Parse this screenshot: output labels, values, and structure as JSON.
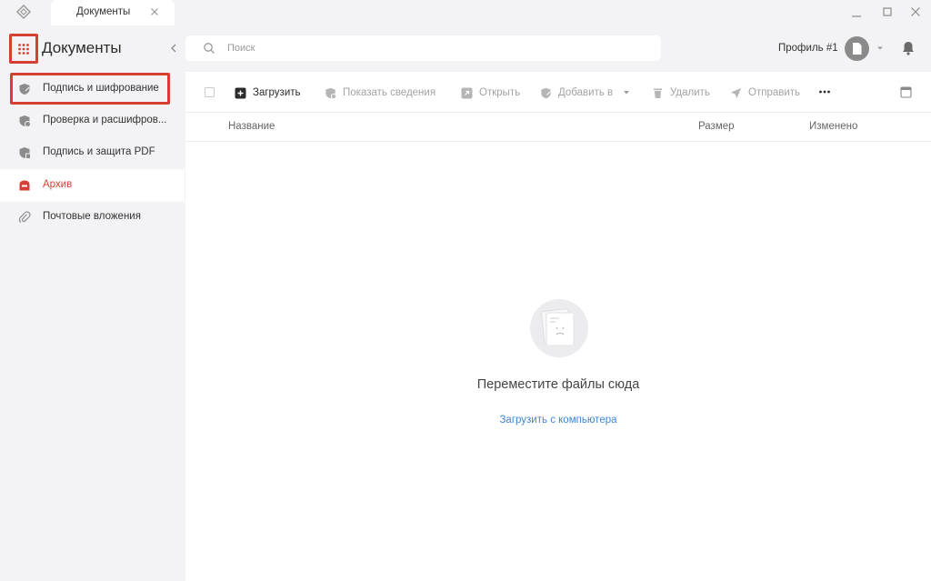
{
  "window": {
    "tab_label": "Документы"
  },
  "sidebar": {
    "title": "Документы",
    "items": [
      {
        "label": "Подпись и шифрование",
        "icon": "shield-sign-icon"
      },
      {
        "label": "Проверка и расшифров...",
        "icon": "shield-check-icon"
      },
      {
        "label": "Подпись и защита PDF",
        "icon": "shield-pdf-icon"
      },
      {
        "label": "Архив",
        "icon": "archive-icon"
      },
      {
        "label": "Почтовые вложения",
        "icon": "paperclip-icon"
      }
    ],
    "active_index": 3
  },
  "header": {
    "search_placeholder": "Поиск",
    "profile_label": "Профиль #1"
  },
  "toolbar": {
    "upload": "Загрузить",
    "show_info": "Показать сведения",
    "open": "Открыть",
    "add_to": "Добавить в",
    "delete": "Удалить",
    "send": "Отправить"
  },
  "table": {
    "columns": [
      "Название",
      "Размер",
      "Изменено"
    ]
  },
  "empty_state": {
    "title": "Переместите файлы сюда",
    "link": "Загрузить с компьютера"
  },
  "colors": {
    "accent": "#d63f33",
    "link": "#3d86d6",
    "sidebar_bg": "#f3f3f5"
  }
}
